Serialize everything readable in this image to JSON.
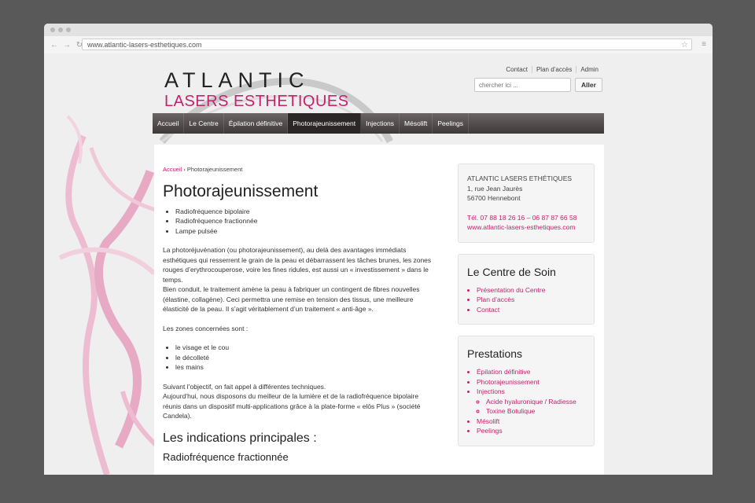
{
  "browser": {
    "url": "www.atlantic-lasers-esthetiques.com"
  },
  "logo": {
    "line1": "ATLANTIC",
    "line2": "LASERS ESTHETIQUES"
  },
  "toplinks": [
    "Contact",
    "Plan d’accès",
    "Admin"
  ],
  "search": {
    "placeholder": "chercher ici ...",
    "button": "Aller"
  },
  "nav": {
    "items": [
      "Accueil",
      "Le Centre",
      "Épilation définitive",
      "Photorajeunissement",
      "Injections",
      "Mésolift",
      "Peelings"
    ],
    "active": "Photorajeunissement"
  },
  "breadcrumb": {
    "home": "Accueil",
    "separator": "›",
    "current": "Photorajeunissement"
  },
  "article": {
    "title": "Photorajeunissement",
    "list1": [
      "Radiofréquence bipolaire",
      "Radiofréquence fractionnée",
      "Lampe pulsée"
    ],
    "p1a": "La photoréjuvénation (ou photorajeunissement), au delà des avantages immédiats esthétiques qui resserrent le grain de la peau et débarrassent les tâches brunes, les zones rouges d’erythrocouperose, voire les fines ridules, est aussi un « investissement » dans le temps.",
    "p1b": "Bien conduit, le traitement amène la peau à fabriquer un contingent de fibres nouvelles (élastine, collagène). Ceci permettra une remise en tension des tissus, une meilleure élasticité de la peau. Il s’agit véritablement d’un traitement « anti-âge ».",
    "p2": "Les zones concernées sont :",
    "list2": [
      "le visage et le cou",
      "le décolleté",
      "les mains"
    ],
    "p3a": "Suivant l’objectif, on fait appel à différentes techniques.",
    "p3b": "Aujourd’hui, nous disposons du meilleur de la lumière et de la radiofréquence bipolaire réunis dans un dispositif multi-applications grâce à la plate-forme « elōs Plus » (société Candela).",
    "h2": "Les indications principales :",
    "h3": "Radiofréquence fractionnée"
  },
  "sidebar": {
    "address": {
      "name": "ATLANTIC LASERS ETHÉTIQUES",
      "street": "1, rue Jean Jaurès",
      "city": "56700 Hennebont",
      "phone": "Tél. 07 88 18 26 16 – 06 87 87 66 58",
      "web": "www.atlantic-lasers-esthetiques.com"
    },
    "centre": {
      "title": "Le Centre de Soin",
      "links": [
        "Présentation du Centre",
        "Plan d’accès",
        "Contact"
      ]
    },
    "prestations": {
      "title": "Prestations",
      "links": [
        "Épilation définitive",
        "Photorajeunissement",
        "Injections"
      ],
      "sublinks": [
        "Acide hyaluronique / Radiesse",
        "Toxine Botulique"
      ],
      "links2": [
        "Mésolift",
        "Peelings"
      ]
    }
  },
  "colors": {
    "accent": "#c4226d",
    "nav_bg": "#4a4444"
  }
}
